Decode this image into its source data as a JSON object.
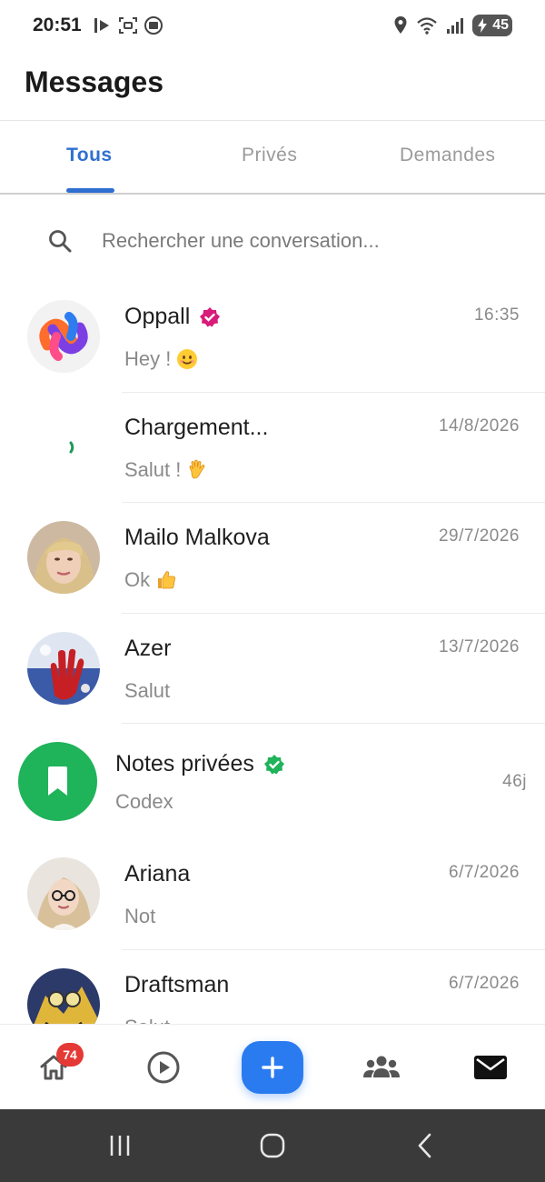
{
  "status_bar": {
    "time": "20:51",
    "battery": "45",
    "icons": [
      "media-icon",
      "screenshot-icon",
      "cast-icon",
      "location-icon",
      "wifi-icon",
      "signal-icon",
      "battery-charging-icon"
    ]
  },
  "header": {
    "title": "Messages"
  },
  "tabs": [
    {
      "label": "Tous",
      "active": true
    },
    {
      "label": "Privés",
      "active": false
    },
    {
      "label": "Demandes",
      "active": false
    }
  ],
  "search": {
    "placeholder": "Rechercher une conversation..."
  },
  "conversations": [
    {
      "name": "Oppall",
      "verified": true,
      "verified_color": "#d81b79",
      "preview": "Hey !",
      "preview_emoji": "smiling-face-emoji",
      "time": "16:35"
    },
    {
      "name": "Chargement...",
      "verified": false,
      "preview": "Salut !",
      "preview_emoji": "waving-hand-emoji",
      "time": "14/8/2026"
    },
    {
      "name": "Mailo Malkova",
      "verified": false,
      "preview": "Ok",
      "preview_emoji": "thumbs-up-emoji",
      "time": "29/7/2026"
    },
    {
      "name": "Azer",
      "verified": false,
      "preview": "Salut",
      "time": "13/7/2026"
    },
    {
      "name": "Notes privées",
      "verified": true,
      "verified_color": "#1fb35a",
      "preview": "Codex",
      "time": "46j"
    },
    {
      "name": "Ariana",
      "verified": false,
      "preview": "Not",
      "time": "6/7/2026"
    },
    {
      "name": "Draftsman",
      "verified": false,
      "preview": "Salut",
      "time": "6/7/2026"
    }
  ],
  "bottom_nav": {
    "home_badge": "74",
    "items": [
      "home-icon",
      "play-icon",
      "add-icon",
      "community-icon",
      "mail-icon"
    ]
  },
  "colors": {
    "accent": "#2f6fd1",
    "fab": "#2b7bf0",
    "notes_green": "#1fb35a",
    "badge_red": "#e53935"
  }
}
